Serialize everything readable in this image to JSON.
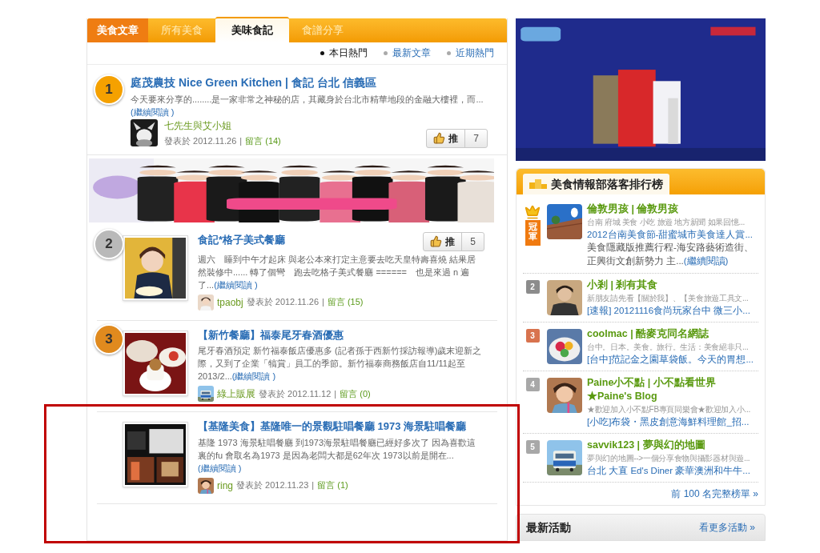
{
  "nav": {
    "section": "美食文章",
    "tabs": [
      {
        "label": "所有美食",
        "selected": false
      },
      {
        "label": "美味食記",
        "selected": true
      },
      {
        "label": "食譜分享",
        "selected": false
      }
    ],
    "filters": [
      {
        "label": "本日熱門",
        "selected": true
      },
      {
        "label": "最新文章",
        "selected": false
      },
      {
        "label": "近期熱門",
        "selected": false
      }
    ]
  },
  "feed": [
    {
      "kind": "text",
      "rank": "1",
      "color": "#f5a100",
      "title": "庭茂農技 Nice Green Kitchen | 食記 台北 信義區",
      "excerpt": "今天要來分享的........是一家非常之神秘的店，其藏身於台北市精華地段的金融大樓裡，而...",
      "more": "(繼續閱讀 )",
      "author": "七先生與艾小姐",
      "posted": "發表於 2012.11.26",
      "sep": "|",
      "comments": "留言 (14)",
      "like_label": "推",
      "like_count": "7"
    },
    {
      "kind": "banner"
    },
    {
      "kind": "thumb",
      "rank": "2",
      "color": "#b9b9b9",
      "title": "食記*格子美式餐廳",
      "excerpt": "週六　睡到中午才起床 與老公本來打定主意要去吃天皇特壽喜燒 結果居然裝修中...... 轉了個彎　跑去吃格子美式餐廳 ======　也是來過 n 遍了...",
      "more": "(繼續閱讀 )",
      "author": "tpaobj",
      "posted": "發表於 2012.11.26",
      "sep": "|",
      "comments": "留言 (15)",
      "like_label": "推",
      "like_count": "5"
    },
    {
      "kind": "thumb",
      "rank": "3",
      "color": "#e08a1e",
      "title": "【新竹餐廳】福泰尾牙春酒優惠",
      "excerpt": "尾牙春酒預定 新竹福泰飯店優惠多 (記者孫于西新竹採訪報導)歲末迎新之際，又到了企業「犒賞」員工的季節。新竹福泰商務飯店自11/11起至2013/2...",
      "more": "(繼續閱讀 )",
      "author": "綠上販展",
      "posted": "發表於 2012.11.12",
      "sep": "|",
      "comments": "留言 (0)"
    },
    {
      "kind": "thumb",
      "title": "【基隆美食】基隆唯一的景觀駐唱餐廳 1973 海景駐唱餐廳",
      "excerpt": "基隆 1973 海景駐唱餐廳 到1973海景駐唱餐廳已經好多次了 因為喜歡這裏的fu 會取名為1973 是因為老闆大都是62年次 1973以前是開在...",
      "more": "(繼續閱讀 )",
      "author": "ring",
      "posted": "發表於 2012.11.23",
      "sep": "|",
      "comments": "留言 (1)"
    }
  ],
  "ranking": {
    "title": "美食情報部落客排行榜",
    "entries": [
      {
        "kind": "crown",
        "rank": "冠軍",
        "color": "#f07a10",
        "name": "倫敦男孩 | 倫敦男孩",
        "about": "台南 府城 美食 小吃 旅遊 地方新聞 如果回憶...",
        "post": "2012台南美食節-甜蜜城市美食達人賞...",
        "excerpt": "美食隱藏版推薦行程-海安路藝術造街、正興街文創新勢力 主...",
        "more": "(繼續閱讀)"
      },
      {
        "kind": "number",
        "rank": "2",
        "color": "#8c8c8c",
        "name": "小剎 | 剎有其食",
        "about": "新朋友請先看【關於我】、【美食旅遊工具文...",
        "post": "[速報] 20121116食尚玩家台中 微三小..."
      },
      {
        "kind": "number",
        "rank": "3",
        "color": "#d8734e",
        "name": "coolmac | 酷麥克同名網誌",
        "about": "台中。日本。美食。旅行。生活：美食絕非只...",
        "post": "[台中]范記金之園草袋飯。今天的胃想..."
      },
      {
        "kind": "number",
        "rank": "4",
        "color": "#a8a8a8",
        "name": "Paine小不點 | 小不點看世界★Paine's Blog",
        "about": "★歡迎加入小不點FB專頁同樂會★歡迎加入小...",
        "post": "[小吃]布袋・黑皮創意海鮮料理館_招..."
      },
      {
        "kind": "number",
        "rank": "5",
        "color": "#a8a8a8",
        "name": "savvik123 | 夢與幻的地圖",
        "about": "夢與幻的地圖-->一個分享食物與攝影器材與遊...",
        "post": "台北 大直 Ed's Diner 豪華澳洲和牛牛..."
      }
    ],
    "more": "前 100 名完整榜單 »"
  },
  "events": {
    "title": "最新活動",
    "more": "看更多活動 »"
  }
}
